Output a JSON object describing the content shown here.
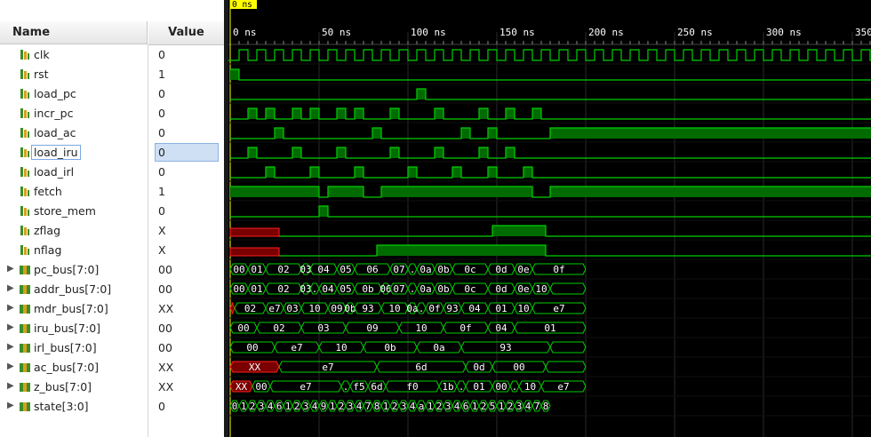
{
  "header": {
    "name": "Name",
    "value": "Value"
  },
  "cursor_label": "0 ns",
  "time_ticks": [
    "0 ns",
    "50 ns",
    "100 ns",
    "150 ns",
    "200 ns",
    "250 ns",
    "300 ns",
    "350"
  ],
  "signals": [
    {
      "name": "clk",
      "value": "0",
      "bus": false
    },
    {
      "name": "rst",
      "value": "1",
      "bus": false
    },
    {
      "name": "load_pc",
      "value": "0",
      "bus": false
    },
    {
      "name": "incr_pc",
      "value": "0",
      "bus": false
    },
    {
      "name": "load_ac",
      "value": "0",
      "bus": false
    },
    {
      "name": "load_iru",
      "value": "0",
      "bus": false,
      "selected": true
    },
    {
      "name": "load_irl",
      "value": "0",
      "bus": false
    },
    {
      "name": "fetch",
      "value": "1",
      "bus": false
    },
    {
      "name": "store_mem",
      "value": "0",
      "bus": false
    },
    {
      "name": "zflag",
      "value": "X",
      "bus": false
    },
    {
      "name": "nflag",
      "value": "X",
      "bus": false
    },
    {
      "name": "pc_bus[7:0]",
      "value": "00",
      "bus": true
    },
    {
      "name": "addr_bus[7:0]",
      "value": "00",
      "bus": true
    },
    {
      "name": "mdr_bus[7:0]",
      "value": "XX",
      "bus": true
    },
    {
      "name": "iru_bus[7:0]",
      "value": "00",
      "bus": true
    },
    {
      "name": "irl_bus[7:0]",
      "value": "00",
      "bus": true
    },
    {
      "name": "ac_bus[7:0]",
      "value": "XX",
      "bus": true
    },
    {
      "name": "z_bus[7:0]",
      "value": "XX",
      "bus": true
    },
    {
      "name": "state[3:0]",
      "value": "0",
      "bus": true
    }
  ],
  "waves": {
    "rst": [
      [
        0,
        1,
        "1"
      ],
      [
        1,
        1000000000.0,
        "0"
      ]
    ],
    "load_pc": [
      [
        0,
        21,
        "0"
      ],
      [
        21,
        22,
        "1"
      ],
      [
        22,
        1000000000.0,
        "0"
      ]
    ],
    "incr_pc": [
      [
        0,
        2,
        "0"
      ],
      [
        2,
        3,
        "1"
      ],
      [
        3,
        4,
        "0"
      ],
      [
        4,
        5,
        "1"
      ],
      [
        5,
        7,
        "0"
      ],
      [
        7,
        8,
        "1"
      ],
      [
        8,
        9,
        "0"
      ],
      [
        9,
        10,
        "1"
      ],
      [
        10,
        12,
        "0"
      ],
      [
        12,
        13,
        "1"
      ],
      [
        13,
        14,
        "0"
      ],
      [
        14,
        15,
        "1"
      ],
      [
        15,
        18,
        "0"
      ],
      [
        18,
        19,
        "1"
      ],
      [
        19,
        23,
        "0"
      ],
      [
        23,
        24,
        "1"
      ],
      [
        24,
        28,
        "0"
      ],
      [
        28,
        29,
        "1"
      ],
      [
        29,
        31,
        "0"
      ],
      [
        31,
        32,
        "1"
      ],
      [
        32,
        34,
        "0"
      ],
      [
        34,
        35,
        "1"
      ],
      [
        35,
        1000000000.0,
        "0"
      ]
    ],
    "load_ac": [
      [
        0,
        5,
        "0"
      ],
      [
        5,
        6,
        "1"
      ],
      [
        6,
        16,
        "0"
      ],
      [
        16,
        17,
        "1"
      ],
      [
        17,
        26,
        "0"
      ],
      [
        26,
        27,
        "1"
      ],
      [
        27,
        29,
        "0"
      ],
      [
        29,
        30,
        "1"
      ],
      [
        30,
        36,
        "0"
      ],
      [
        36,
        1000000000.0,
        "1"
      ]
    ],
    "load_iru": [
      [
        0,
        2,
        "0"
      ],
      [
        2,
        3,
        "1"
      ],
      [
        3,
        7,
        "0"
      ],
      [
        7,
        8,
        "1"
      ],
      [
        8,
        12,
        "0"
      ],
      [
        12,
        13,
        "1"
      ],
      [
        13,
        18,
        "0"
      ],
      [
        18,
        19,
        "1"
      ],
      [
        19,
        23,
        "0"
      ],
      [
        23,
        24,
        "1"
      ],
      [
        24,
        28,
        "0"
      ],
      [
        28,
        29,
        "1"
      ],
      [
        29,
        31,
        "0"
      ],
      [
        31,
        32,
        "1"
      ],
      [
        32,
        1000000000.0,
        "0"
      ]
    ],
    "load_irl": [
      [
        0,
        4,
        "0"
      ],
      [
        4,
        5,
        "1"
      ],
      [
        5,
        9,
        "0"
      ],
      [
        9,
        10,
        "1"
      ],
      [
        10,
        14,
        "0"
      ],
      [
        14,
        15,
        "1"
      ],
      [
        15,
        20,
        "0"
      ],
      [
        20,
        21,
        "1"
      ],
      [
        21,
        25,
        "0"
      ],
      [
        25,
        26,
        "1"
      ],
      [
        26,
        29,
        "0"
      ],
      [
        29,
        30,
        "1"
      ],
      [
        30,
        33,
        "0"
      ],
      [
        33,
        34,
        "1"
      ],
      [
        34,
        1000000000.0,
        "0"
      ]
    ],
    "fetch": [
      [
        0,
        10,
        "1"
      ],
      [
        10,
        11,
        "0"
      ],
      [
        11,
        15,
        "1"
      ],
      [
        15,
        17,
        "0"
      ],
      [
        17,
        34,
        "1"
      ],
      [
        34,
        36,
        "0"
      ],
      [
        36,
        1000000000.0,
        "1"
      ]
    ],
    "store_mem": [
      [
        0,
        10,
        "0"
      ],
      [
        10,
        11,
        "1"
      ],
      [
        11,
        1000000000.0,
        "0"
      ]
    ],
    "zflag": [
      [
        0,
        5.5,
        "X"
      ],
      [
        5.5,
        29.5,
        "0"
      ],
      [
        29.5,
        35.5,
        "1"
      ],
      [
        35.5,
        1000000000.0,
        "0"
      ]
    ],
    "nflag": [
      [
        0,
        5.5,
        "X"
      ],
      [
        5.5,
        16.5,
        "0"
      ],
      [
        16.5,
        35.5,
        "1"
      ],
      [
        35.5,
        1000000000.0,
        "0"
      ]
    ],
    "pc_bus[7:0]": [
      [
        0,
        2,
        "00"
      ],
      [
        2,
        4,
        "01"
      ],
      [
        4,
        8,
        "02"
      ],
      [
        8,
        9,
        "03"
      ],
      [
        9,
        12,
        "04"
      ],
      [
        12,
        14,
        "05"
      ],
      [
        14,
        18,
        "06"
      ],
      [
        18,
        20,
        "07"
      ],
      [
        20,
        21,
        "."
      ],
      [
        21,
        23,
        "0a"
      ],
      [
        23,
        25,
        "0b"
      ],
      [
        25,
        29,
        "0c"
      ],
      [
        29,
        32,
        "0d"
      ],
      [
        32,
        34,
        "0e"
      ],
      [
        34,
        40,
        "0f"
      ]
    ],
    "addr_bus[7:0]": [
      [
        0,
        2,
        "00"
      ],
      [
        2,
        4,
        "01"
      ],
      [
        4,
        8,
        "02"
      ],
      [
        8,
        9,
        "03"
      ],
      [
        9,
        10,
        "."
      ],
      [
        10,
        12,
        "04"
      ],
      [
        12,
        14,
        "05"
      ],
      [
        14,
        17,
        "0b"
      ],
      [
        17,
        18,
        "06"
      ],
      [
        18,
        20,
        "07"
      ],
      [
        20,
        21,
        "."
      ],
      [
        21,
        23,
        "0a"
      ],
      [
        23,
        25,
        "0b"
      ],
      [
        25,
        29,
        "0c"
      ],
      [
        29,
        32,
        "0d"
      ],
      [
        32,
        34,
        "0e"
      ],
      [
        34,
        36,
        "10"
      ],
      [
        36,
        40,
        ""
      ]
    ],
    "mdr_bus[7:0]": [
      [
        0,
        0.5,
        "X"
      ],
      [
        0.5,
        4,
        "02"
      ],
      [
        4,
        6,
        "e7"
      ],
      [
        6,
        8,
        "03"
      ],
      [
        8,
        11,
        "10"
      ],
      [
        11,
        13,
        "09"
      ],
      [
        13,
        14,
        "0b"
      ],
      [
        14,
        17,
        "93"
      ],
      [
        17,
        20,
        "10"
      ],
      [
        20,
        21,
        "0a"
      ],
      [
        21,
        22,
        "."
      ],
      [
        22,
        24,
        "0f"
      ],
      [
        24,
        26,
        "93"
      ],
      [
        26,
        29,
        "04"
      ],
      [
        29,
        32,
        "01"
      ],
      [
        32,
        34,
        "10"
      ],
      [
        34,
        40,
        "e7"
      ]
    ],
    "iru_bus[7:0]": [
      [
        0,
        3,
        "00"
      ],
      [
        3,
        8,
        "02"
      ],
      [
        8,
        13,
        "03"
      ],
      [
        13,
        19,
        "09"
      ],
      [
        19,
        24,
        "10"
      ],
      [
        24,
        29,
        "0f"
      ],
      [
        29,
        32,
        "04"
      ],
      [
        32,
        40,
        "01"
      ]
    ],
    "irl_bus[7:0]": [
      [
        0,
        5,
        "00"
      ],
      [
        5,
        10,
        "e7"
      ],
      [
        10,
        15,
        "10"
      ],
      [
        15,
        21,
        "0b"
      ],
      [
        21,
        26,
        "0a"
      ],
      [
        26,
        36,
        "93"
      ],
      [
        36,
        40,
        ""
      ]
    ],
    "ac_bus[7:0]": [
      [
        0,
        5.5,
        "XX"
      ],
      [
        5.5,
        16.5,
        "e7"
      ],
      [
        16.5,
        26.5,
        "6d"
      ],
      [
        26.5,
        29.5,
        "0d"
      ],
      [
        29.5,
        35.5,
        "00"
      ],
      [
        35.5,
        40,
        ""
      ]
    ],
    "z_bus[7:0]": [
      [
        0,
        2.5,
        "XX"
      ],
      [
        2.5,
        4.5,
        "00"
      ],
      [
        4.5,
        12.5,
        "e7"
      ],
      [
        12.5,
        13.5,
        "."
      ],
      [
        13.5,
        15.5,
        "f5"
      ],
      [
        15.5,
        17.5,
        "6d"
      ],
      [
        17.5,
        23.5,
        "f0"
      ],
      [
        23.5,
        25.5,
        "1b"
      ],
      [
        25.5,
        26.5,
        "."
      ],
      [
        26.5,
        29.5,
        "01"
      ],
      [
        29.5,
        31.5,
        "00"
      ],
      [
        31.5,
        32.5,
        "."
      ],
      [
        32.5,
        35,
        "10"
      ],
      [
        35,
        40,
        "e7"
      ]
    ],
    "state[3:0]": [
      [
        0,
        1,
        "0"
      ],
      [
        1,
        2,
        "1"
      ],
      [
        2,
        3,
        "2"
      ],
      [
        3,
        4,
        "3"
      ],
      [
        4,
        5,
        "4"
      ],
      [
        5,
        6,
        "6"
      ],
      [
        6,
        7,
        "1"
      ],
      [
        7,
        8,
        "2"
      ],
      [
        8,
        9,
        "3"
      ],
      [
        9,
        10,
        "4"
      ],
      [
        10,
        11,
        "9"
      ],
      [
        11,
        12,
        "1"
      ],
      [
        12,
        13,
        "2"
      ],
      [
        13,
        14,
        "3"
      ],
      [
        14,
        15,
        "4"
      ],
      [
        15,
        16,
        "7"
      ],
      [
        16,
        17,
        "8"
      ],
      [
        17,
        18,
        "1"
      ],
      [
        18,
        19,
        "2"
      ],
      [
        19,
        20,
        "3"
      ],
      [
        20,
        21,
        "4"
      ],
      [
        21,
        22,
        "a"
      ],
      [
        22,
        23,
        "1"
      ],
      [
        23,
        24,
        "2"
      ],
      [
        24,
        25,
        "3"
      ],
      [
        25,
        26,
        "4"
      ],
      [
        26,
        27,
        "6"
      ],
      [
        27,
        28,
        "1"
      ],
      [
        28,
        29,
        "2"
      ],
      [
        29,
        30,
        "5"
      ],
      [
        30,
        31,
        "1"
      ],
      [
        31,
        32,
        "2"
      ],
      [
        32,
        33,
        "3"
      ],
      [
        33,
        34,
        "4"
      ],
      [
        34,
        35,
        "7"
      ],
      [
        35,
        36,
        "8"
      ]
    ]
  },
  "colors": {
    "wave": "#00d000",
    "wave_fill": "#006c00",
    "x_fill": "#7a0000",
    "x_line": "#ff2020",
    "grid": "#2a2a2a",
    "cursor": "#ffff00",
    "text": "#ffffff"
  }
}
